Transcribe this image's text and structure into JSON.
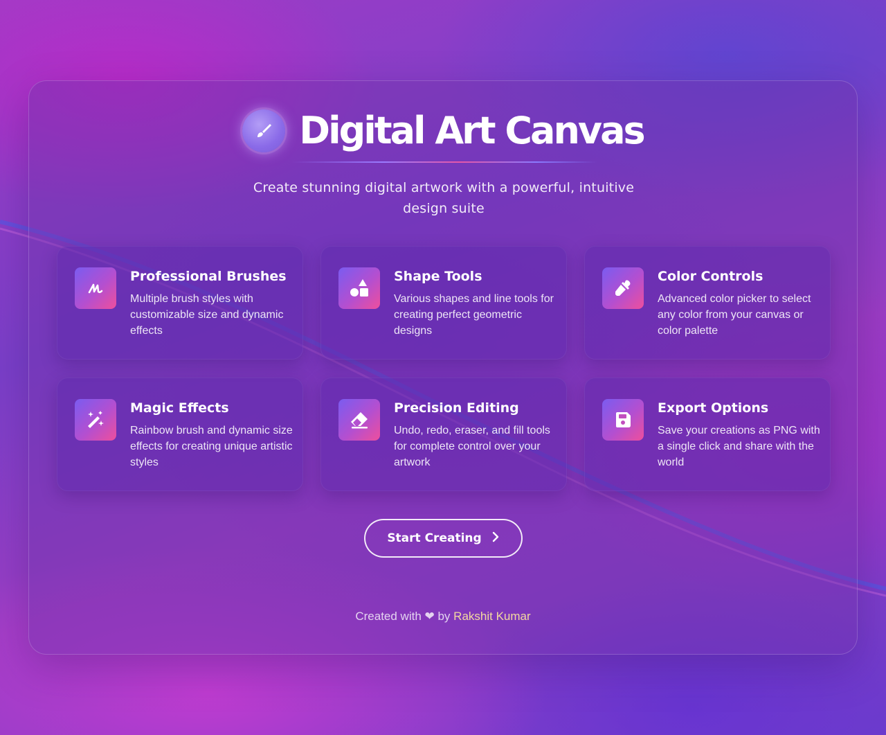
{
  "header": {
    "title": "Digital Art Canvas",
    "subtitle": "Create stunning digital artwork with a powerful, intuitive design suite"
  },
  "features": [
    {
      "icon": "brush-stroke-icon",
      "title": "Professional Brushes",
      "description": "Multiple brush styles with customizable size and dynamic effects"
    },
    {
      "icon": "shapes-icon",
      "title": "Shape Tools",
      "description": "Various shapes and line tools for creating perfect geometric designs"
    },
    {
      "icon": "eyedropper-icon",
      "title": "Color Controls",
      "description": "Advanced color picker to select any color from your canvas or color palette"
    },
    {
      "icon": "magic-wand-icon",
      "title": "Magic Effects",
      "description": "Rainbow brush and dynamic size effects for creating unique artistic styles"
    },
    {
      "icon": "eraser-icon",
      "title": "Precision Editing",
      "description": "Undo, redo, eraser, and fill tools for complete control over your artwork"
    },
    {
      "icon": "save-icon",
      "title": "Export Options",
      "description": "Save your creations as PNG with a single click and share with the world"
    }
  ],
  "cta": {
    "label": "Start Creating"
  },
  "footer": {
    "prefix": "Created with ❤ by",
    "author": "Rakshit Kumar"
  },
  "colors": {
    "accent_start": "#7a5cf0",
    "accent_end": "#ee4f9c",
    "author": "#f3d9a0"
  }
}
